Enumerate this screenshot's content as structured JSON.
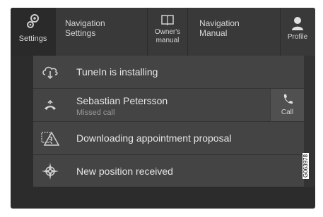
{
  "topbar": {
    "settings_label": "Settings",
    "navigation_settings_label": "Navigation\nSettings",
    "owners_manual_label": "Owner's manual",
    "navigation_manual_label": "Navigation\nManual",
    "profile_label": "Profile"
  },
  "notifications": [
    {
      "title": "TuneIn is installing",
      "icon": "cloud-download-icon"
    },
    {
      "title": "Sebastian Petersson",
      "subtitle": "Missed call",
      "icon": "missed-call-icon",
      "action_label": "Call"
    },
    {
      "title": "Downloading appointment proposal",
      "icon": "warning-download-icon"
    },
    {
      "title": "New position received",
      "icon": "compass-position-icon"
    }
  ],
  "image_code": "G063978"
}
